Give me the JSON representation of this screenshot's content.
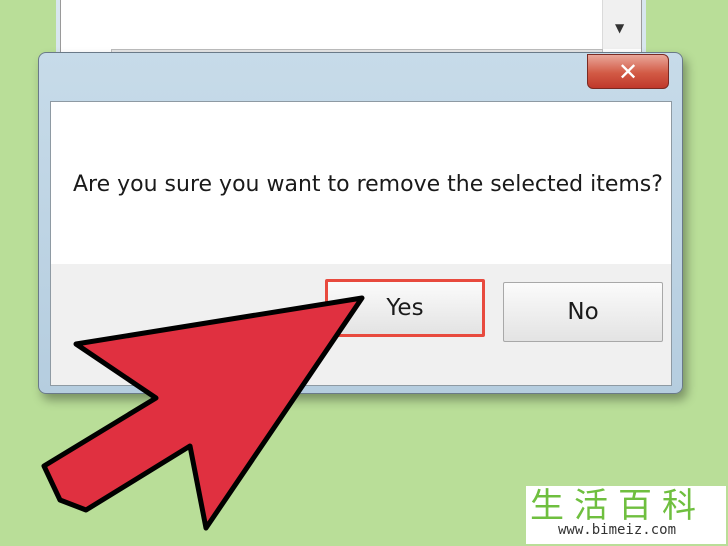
{
  "dialog": {
    "close_icon": "close-icon",
    "message": "Are you sure you want to remove the selected items?",
    "yes_label": "Yes",
    "no_label": "No"
  },
  "background_window": {
    "dropdown_icon": "chevron-down-icon"
  },
  "annotation": {
    "arrow_color": "#e03040",
    "highlight_color": "#e84a3e"
  },
  "watermark": {
    "chinese": "生活百科",
    "url": "www.bimeiz.com"
  }
}
